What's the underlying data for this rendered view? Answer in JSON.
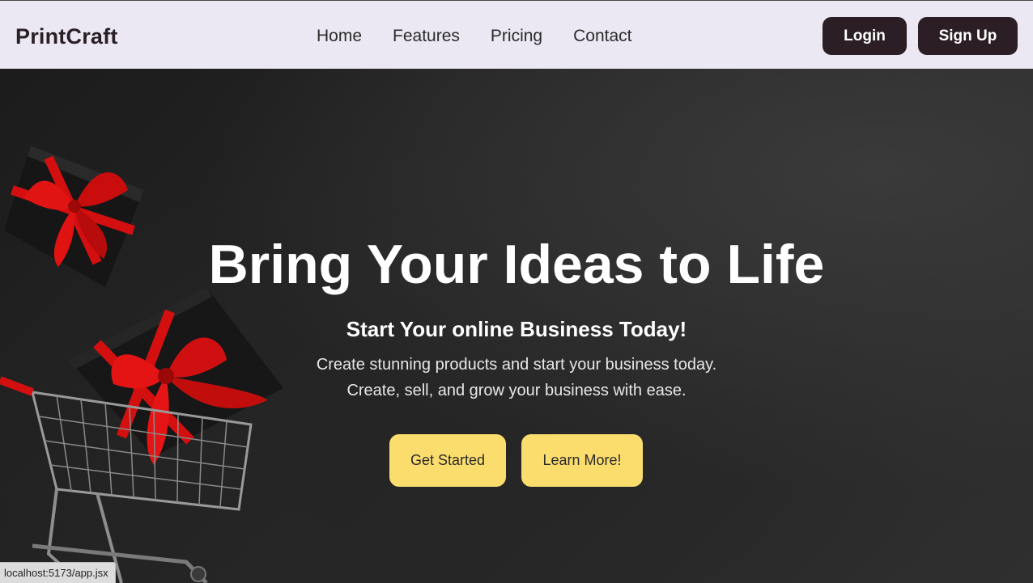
{
  "navbar": {
    "brand": "PrintCraft",
    "links": [
      {
        "label": "Home"
      },
      {
        "label": "Features"
      },
      {
        "label": "Pricing"
      },
      {
        "label": "Contact"
      }
    ],
    "login_label": "Login",
    "signup_label": "Sign Up"
  },
  "hero": {
    "title": "Bring Your Ideas to Life",
    "subtitle": "Start Your online Business Today!",
    "description_line1": "Create stunning products and start your business today.",
    "description_line2": "Create, sell, and grow your business with ease.",
    "primary_cta": "Get Started",
    "secondary_cta": "Learn More!",
    "background_image": "gift-boxes-shopping-cart"
  },
  "status_bar": {
    "url": "localhost:5173/app.jsx"
  },
  "colors": {
    "navbar_bg": "#ebe8f3",
    "nav_button_bg": "#2b1f25",
    "cta_bg": "#fbdd6e",
    "hero_bg": "#1f1f1f",
    "ribbon_red": "#d40f0f"
  }
}
